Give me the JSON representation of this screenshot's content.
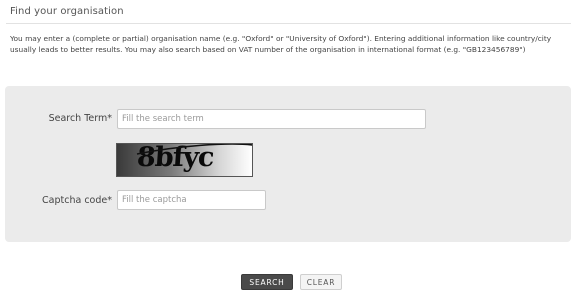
{
  "heading": "Find your organisation",
  "help_text": "You may enter a (complete or partial) organisation name (e.g. \"Oxford\" or \"University of Oxford\"). Entering additional information like country/city usually leads to better results. You may also search based on VAT number of the organisation in international format (e.g. \"GB123456789\")",
  "form": {
    "search_term_label": "Search Term*",
    "search_term_placeholder": "Fill the search term",
    "search_term_value": "",
    "captcha_image_text": "8bfyc",
    "captcha_label": "Captcha code*",
    "captcha_placeholder": "Fill the captcha",
    "captcha_value": ""
  },
  "actions": {
    "search_label": "SEARCH",
    "clear_label": "CLEAR"
  },
  "colors": {
    "panel_bg": "#ebebeb",
    "primary_button": "#4a4a4a",
    "secondary_button": "#f4f4f4"
  }
}
